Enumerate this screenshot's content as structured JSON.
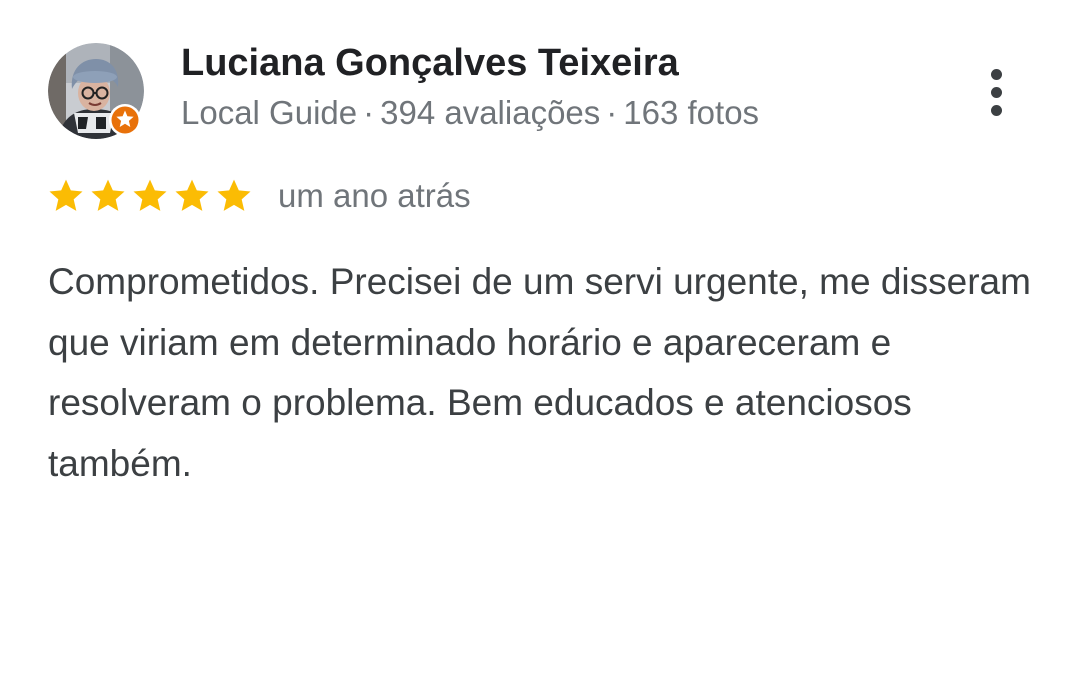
{
  "review": {
    "reviewer": {
      "name": "Luciana Gonçalves Teixeira",
      "badge_label": "Local Guide",
      "reviews_count": "394 avaliações",
      "photos_count": "163 fotos",
      "separator": "·",
      "avatar_icon": "user-avatar-photo",
      "badge_icon": "local-guide-star-badge-icon"
    },
    "rating": {
      "stars": 5,
      "max_stars": 5,
      "star_icon": "star-icon",
      "star_color": "#fbbc04"
    },
    "date": "um ano atrás",
    "text": "Comprometidos. Precisei de um servi urgente, me disseram que viriam em determinado horário e apareceram e resolveram o problema. Bem educados e atenciosos também.",
    "more_options_icon": "more-vert-icon"
  },
  "colors": {
    "name": "#202124",
    "meta": "#70757a",
    "body_text": "#3c4043",
    "badge_orange": "#e8710a"
  }
}
